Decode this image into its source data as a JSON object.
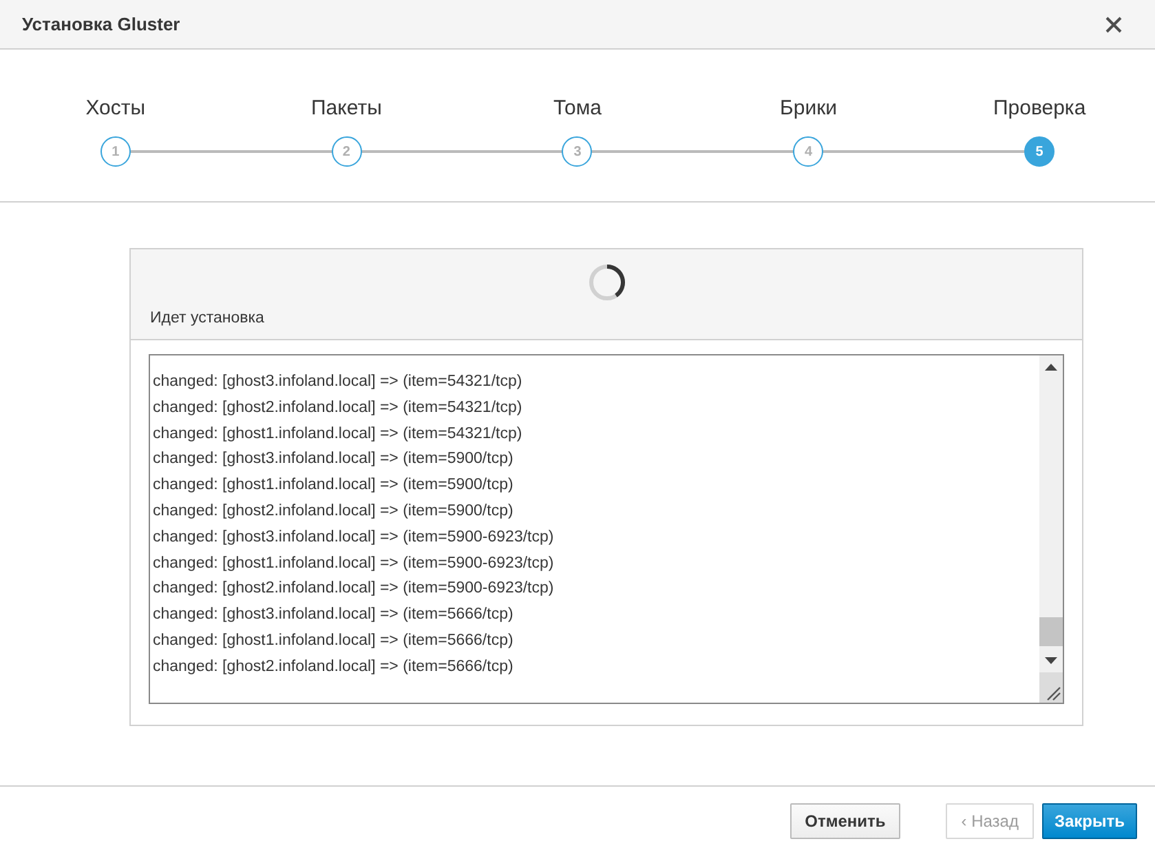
{
  "dialog": {
    "title": "Установка Gluster"
  },
  "steps": [
    {
      "label": "Хосты",
      "number": "1",
      "selected": false
    },
    {
      "label": "Пакеты",
      "number": "2",
      "selected": false
    },
    {
      "label": "Тома",
      "number": "3",
      "selected": false
    },
    {
      "label": "Брики",
      "number": "4",
      "selected": false
    },
    {
      "label": "Проверка",
      "number": "5",
      "selected": true
    }
  ],
  "progress": {
    "status": "Идет установка"
  },
  "log": {
    "lines": [
      "changed: [ghost3.infoland.local] => (item=54321/tcp)",
      "changed: [ghost2.infoland.local] => (item=54321/tcp)",
      "changed: [ghost1.infoland.local] => (item=54321/tcp)",
      "changed: [ghost3.infoland.local] => (item=5900/tcp)",
      "changed: [ghost1.infoland.local] => (item=5900/tcp)",
      "changed: [ghost2.infoland.local] => (item=5900/tcp)",
      "changed: [ghost3.infoland.local] => (item=5900-6923/tcp)",
      "changed: [ghost1.infoland.local] => (item=5900-6923/tcp)",
      "changed: [ghost2.infoland.local] => (item=5900-6923/tcp)",
      "changed: [ghost3.infoland.local] => (item=5666/tcp)",
      "changed: [ghost1.infoland.local] => (item=5666/tcp)",
      "changed: [ghost2.infoland.local] => (item=5666/tcp)"
    ]
  },
  "buttons": [
    {
      "label": "Отменить",
      "kind": "default",
      "disabled": false
    },
    {
      "label": "‹ Назад",
      "kind": "default",
      "disabled": true
    },
    {
      "label": "Закрыть",
      "kind": "primary",
      "disabled": false
    }
  ]
}
